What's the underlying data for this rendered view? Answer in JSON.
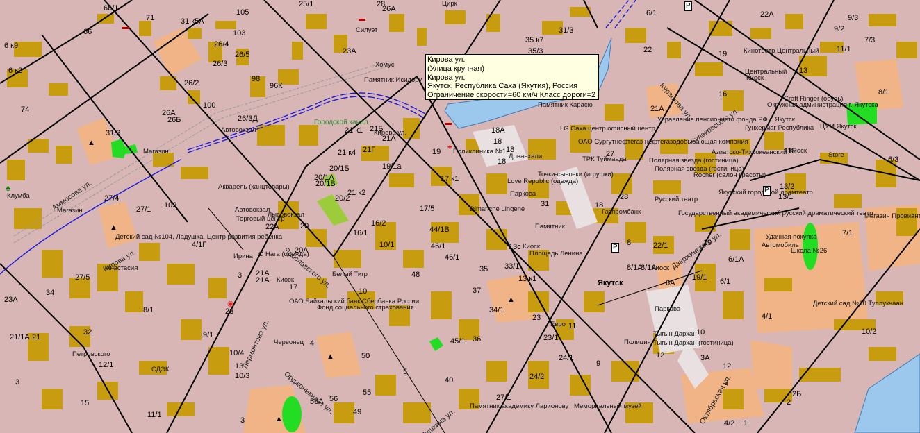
{
  "tooltip": {
    "lines": [
      "Кирова ул.",
      "(Улица крупная)",
      "Кирова ул.",
      "Якутск, Республика Саха (Якутия), Россия",
      "Ограничение скорости=60 км/ч Класс дороги=2"
    ]
  },
  "colors": {
    "background": "#d9b6b6",
    "building": "#c79c0f",
    "park": "#f0b487",
    "green": "#22dd22",
    "water": "#9dc8ee",
    "road": "#000000"
  },
  "labels": {
    "l1": "66/1",
    "l2": "71",
    "l3": "31 к5А",
    "l4": "105",
    "l5": "25/1",
    "l6": "28",
    "l7": "26А",
    "l8": "Цирк",
    "l9": "6 к9",
    "l10": "66",
    "l11": "103",
    "l12": "Силуэт",
    "l13": "31/3",
    "l14": "6/1",
    "l15": "22А",
    "l16": "9/3",
    "l17": "26/4",
    "l18": "26/5",
    "l19": "23А",
    "l20": "35 к7",
    "l21": "35/3",
    "l22": "22",
    "l23": "19",
    "l24": "9/2",
    "l25": "6 к2",
    "l26": "26/3",
    "l27": "98",
    "l28": "96К",
    "l29": "Хомус",
    "l30": "Кинотеатр Центральный",
    "l31": "7/3",
    "l32": "26/2",
    "l33": "Памятник Исидору",
    "l34": "13",
    "l35": "11/1",
    "l36": "74",
    "l37": "100",
    "l38": "26А",
    "l39": "26Б",
    "l40": "26/3Д",
    "l41": "Автовокзал",
    "l42": "Городской канал",
    "l43": "21 к1",
    "l44": "21Б",
    "l45": "Кирова ул.",
    "l46": "21А",
    "l47": "18А",
    "l48": "18",
    "l49": "18",
    "l50": "18",
    "l51": "Поликлиника №1",
    "l52": "Донаехали",
    "l53": "19",
    "l54": "31/3",
    "l55": "Магазин",
    "l56": "21 к4",
    "l57": "21Г",
    "l58": "19/1а",
    "l59": "20/1А",
    "l60": "20/1Б",
    "l61": "20/1В",
    "l62": "20/2",
    "l63": "21 к2",
    "l64": "17 к1",
    "l65": "Акварель (канцтовары)",
    "l66": "Клумба",
    "l67": "Магазин",
    "l68": "27/4",
    "l69": "27/1",
    "l70": "102",
    "l71": "Автовокзал",
    "l72": "Лысовокзал",
    "l73": "17/5",
    "l74": "Dimanche Lingene",
    "l75": "Торговый центр",
    "l76": "22А",
    "l77": "20",
    "l78": "16/2",
    "l79": "44/1В",
    "l80": "31",
    "l81": "Памятник",
    "l82": "Детский сад №104, Ладушка, Центр развития ребенка",
    "l83": "4/1Г",
    "l84": "16/1",
    "l85": "10/1",
    "l86": "46/1",
    "l87": "13с",
    "l88": "Киоск",
    "l89": "Площадь Ленина",
    "l90": "46/1",
    "l91": "Ирина",
    "l92": "20А",
    "l93": "О Нага (одежда)",
    "l94": "Анастасия",
    "l95": "Белый Тигр",
    "l96": "21А",
    "l97": "21А",
    "l98": "Киоск",
    "l99": "17",
    "l100": "48",
    "l101": "35",
    "l102": "33/1",
    "l103": "13 к1",
    "l104": "27/5",
    "l105": "3",
    "l106": "10",
    "l107": "ОАО Байкальский банк Сбербанка России",
    "l108": "Фонд социального страхования",
    "l109": "37",
    "l110": "34",
    "l111": "23А",
    "l112": "23",
    "l113": "8/1",
    "l114": "34/1",
    "l115": "21/1А",
    "l116": "21",
    "l117": "32",
    "l118": "9/1",
    "l119": "4",
    "l120": "Червонец",
    "l121": "23",
    "l122": "Евро",
    "l123": "11",
    "l124": "23/1",
    "l125": "45/1",
    "l126": "36",
    "l127": "Петровского",
    "l128": "12/1",
    "l129": "10/4",
    "l130": "50",
    "l131": "24/1",
    "l132": "9",
    "l133": "СДЭК",
    "l134": "13",
    "l135": "10/3",
    "l136": "3",
    "l137": "5",
    "l138": "40",
    "l139": "24/2",
    "l140": "15",
    "l141": "56А",
    "l142": "56",
    "l143": "55",
    "l144": "49",
    "l145": "27/1",
    "l146": "Памятник академику Ларионову",
    "l147": "Мемориальный музей",
    "l148": "11/1",
    "l149": "3",
    "l150": "Центральный",
    "l151": "Киоск",
    "l152": "16",
    "l153": "Craft Ringer (обувь)",
    "l154": "Окружная администрация г. Якутска",
    "l155": "8/1",
    "l156": "ЦУМ Якутск",
    "l157": "Памятник Карасю",
    "l158": "Управление пенсионного фонда РФ г. Якутск",
    "l159": "Гунхермаг Республика",
    "l160": "21А",
    "l161": "LG Саха центр офисный центр",
    "l162": "ОАО Сургутнефтегаз нефтегазодобывающая компания",
    "l163": "27",
    "l164": "ТРК Туймаада",
    "l165": "Полярная звезда (гостиница)",
    "l166": "Полярная звезда (гостиница)",
    "l167": "Азиатско-Тихоокеанский",
    "l168": "11Б",
    "l169": "Киоск",
    "l170": "Store",
    "l171": "6/3",
    "l172": "Точки-сыночки (игрушки)",
    "l173": "Love Republic (одежда)",
    "l174": "Rocher (салон красоты)",
    "l175": "Якутский городской драмтеатр",
    "l176": "13/2",
    "l177": "Паркова",
    "l178": "28",
    "l179": "Русский театр",
    "l180": "18",
    "l181": "Газпромбанк",
    "l182": "Государственный академический русский драматический театр",
    "l183": "Магазин Провиант",
    "l184": "13/1",
    "l185": "Якутск",
    "l186": "8",
    "l187": "22/1",
    "l188": "19",
    "l189": "8/1А",
    "l190": "8/1А",
    "l191": "Киоск",
    "l192": "6/1А",
    "l193": "Удачная покупка",
    "l194": "Автомобиль",
    "l195": "Школа №26",
    "l196": "7/1",
    "l197": "6А",
    "l198": "19/1",
    "l199": "6/1",
    "l200": "4/1",
    "l201": "Детский сад №10 Туллукчаан",
    "l202": "Паркова",
    "l203": "10/2",
    "l204": "10",
    "l205": "Полиция",
    "l206": "Тыгын Дархан",
    "l207": "Тыгын Дархан (гостиница)",
    "l208": "12",
    "l209": "3А",
    "l210": "12",
    "l211": "3",
    "l212": "2Б",
    "l213": "2",
    "l214": "4/2",
    "l215": "1",
    "l216": "Аммосова ул.",
    "l217": "Кирова ул.",
    "l218": "Ярославского ул.",
    "l219": "Орджоникидзе ул.",
    "l220": "Лермонтова ул.",
    "l221": "Пушкина ул.",
    "l222": "Дзержинского ул.",
    "l223": "Курашова ул.",
    "l224": "Октябрьская ул.",
    "l225": "Кулаковского ул."
  }
}
